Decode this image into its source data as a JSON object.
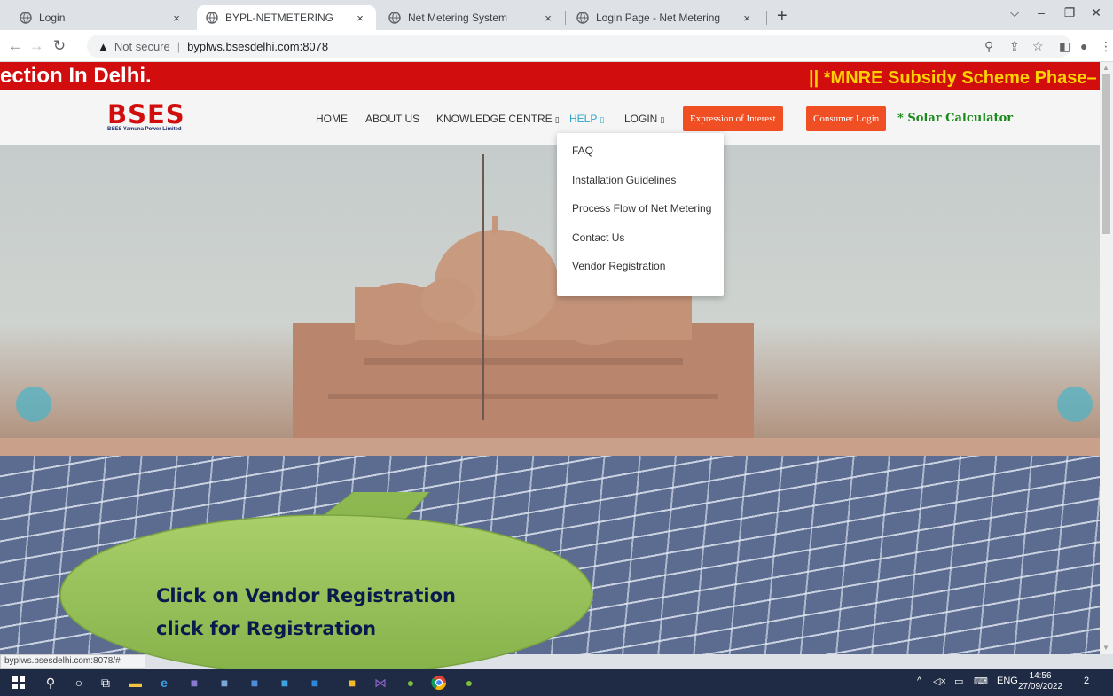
{
  "browser": {
    "tabs": [
      {
        "title": "Login",
        "active": false
      },
      {
        "title": "BYPL-NETMETERING",
        "active": true
      },
      {
        "title": "Net Metering System",
        "active": false
      },
      {
        "title": "Login Page - Net Metering",
        "active": false
      }
    ],
    "close_glyph": "×",
    "new_tab_glyph": "+",
    "security_label": "Not secure",
    "url": "byplws.bsesdelhi.com:8078",
    "status_url": "byplws.bsesdelhi.com:8078/#"
  },
  "page": {
    "marquee_left": "ection In Delhi.",
    "marquee_right": "||  *MNRE Subsidy Scheme Phase–",
    "logo": {
      "word": "BSES",
      "subtitle": "BSES Yamuna Power Limited"
    },
    "nav": [
      {
        "label": "HOME",
        "has_caret": false
      },
      {
        "label": "ABOUT US",
        "has_caret": false
      },
      {
        "label": "KNOWLEDGE CENTRE",
        "has_caret": true
      },
      {
        "label": "HELP",
        "has_caret": true
      },
      {
        "label": "LOGIN",
        "has_caret": true
      }
    ],
    "caret_glyph": "▯",
    "buttons": {
      "expression": "Expression of Interest",
      "consumer_login": "Consumer Login"
    },
    "solar_calculator": "* Solar Calculator",
    "help_menu": [
      "FAQ",
      "Installation Guidelines",
      "Process Flow of Net Metering",
      "Contact Us",
      "Vendor Registration"
    ],
    "callout": {
      "line1": "Click on Vendor Registration",
      "line2": "click for Registration"
    }
  },
  "taskbar": {
    "tray_lang": "ENG",
    "time": "14:56",
    "date": "27/09/2022",
    "notification_count": "2"
  },
  "colors": {
    "marquee_bg": "#d20d0d",
    "marquee_highlight": "#ffd200",
    "accent_orange": "#f04e23",
    "nav_active": "#2aa5c8",
    "solar_green": "#1a8a1a",
    "callout_fill": "#97c25a"
  }
}
